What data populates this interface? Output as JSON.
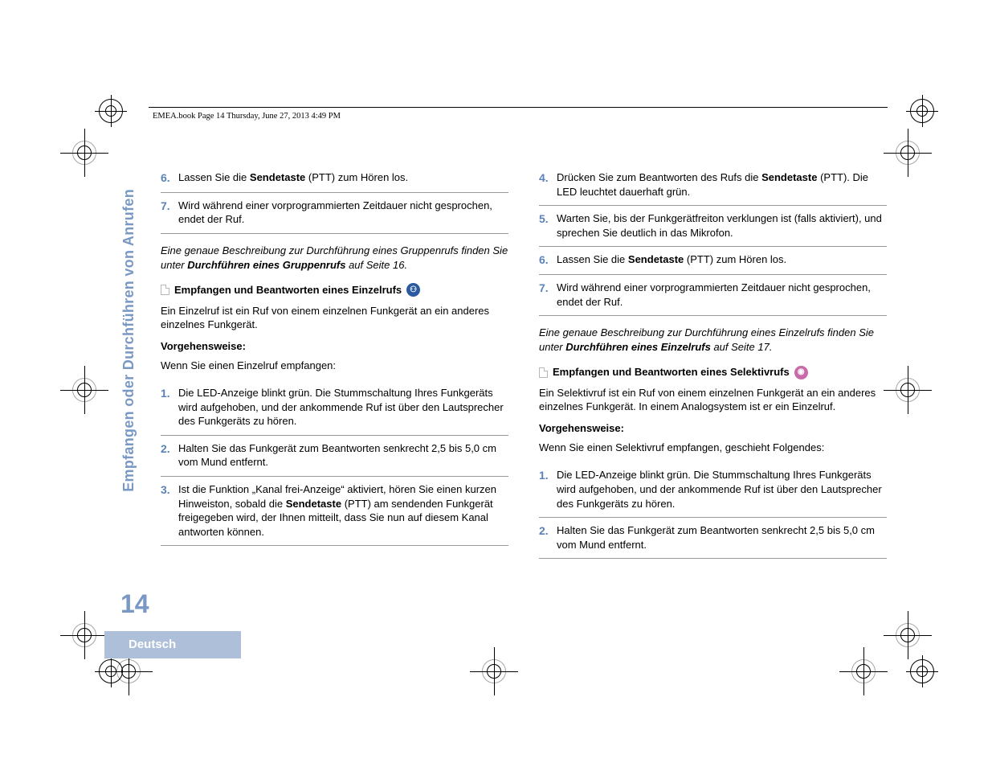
{
  "header": "EMEA.book  Page 14  Thursday, June 27, 2013  4:49 PM",
  "side_title": "Empfangen oder Durchführen von Anrufen",
  "page_number": "14",
  "footer_lang": "Deutsch",
  "left": {
    "topSteps": [
      {
        "n": "6.",
        "html": "Lassen Sie die <b>Sendetaste</b> (PTT) zum Hören los."
      },
      {
        "n": "7.",
        "html": "Wird während einer vorprogrammierten Zeitdauer nicht gesprochen, endet der Ruf."
      }
    ],
    "note_html": "Eine genaue Beschreibung zur Durchführung eines Gruppenrufs finden Sie unter <b>Durchführen eines Gruppenrufs</b> auf Seite 16.",
    "subhead": "Empfangen und Beantworten eines Einzelrufs",
    "intro": "Ein Einzelruf ist ein Ruf von einem einzelnen Funkgerät an ein anderes einzelnes Funkgerät.",
    "proc_label": "Vorgehensweise:",
    "proc_intro": "Wenn Sie einen Einzelruf empfangen:",
    "steps": [
      {
        "n": "1.",
        "html": "Die LED-Anzeige blinkt grün. Die Stummschaltung Ihres Funkgeräts wird aufgehoben, und der ankommende Ruf ist über den Lautsprecher des Funkgeräts zu hören."
      },
      {
        "n": "2.",
        "html": "Halten Sie das Funkgerät zum Beantworten senkrecht 2,5 bis 5,0 cm vom Mund entfernt."
      },
      {
        "n": "3.",
        "html": "Ist die Funktion „Kanal frei-Anzeige“ aktiviert, hören Sie einen kurzen Hinweiston, sobald die <b>Sendetaste</b> (PTT) am sendenden Funkgerät freigegeben wird, der Ihnen mitteilt, dass Sie nun auf diesem Kanal antworten können."
      }
    ]
  },
  "right": {
    "topSteps": [
      {
        "n": "4.",
        "html": "Drücken Sie zum Beantworten des Rufs die <b>Sendetaste</b> (PTT). Die LED leuchtet dauerhaft grün."
      },
      {
        "n": "5.",
        "html": "Warten Sie, bis der Funkgerätfreiton verklungen ist (falls aktiviert), und sprechen Sie deutlich in das Mikrofon."
      },
      {
        "n": "6.",
        "html": "Lassen Sie die <b>Sendetaste</b> (PTT) zum Hören los."
      },
      {
        "n": "7.",
        "html": "Wird während einer vorprogrammierten Zeitdauer nicht gesprochen, endet der Ruf."
      }
    ],
    "note_html": "Eine genaue Beschreibung zur Durchführung eines Einzelrufs finden Sie unter <b>Durchführen eines Einzelrufs</b> auf Seite 17.",
    "subhead": "Empfangen und Beantworten eines Selektivrufs",
    "intro": "Ein Selektivruf ist ein Ruf von einem einzelnen Funkgerät an ein anderes einzelnes Funkgerät. In einem Analogsystem ist er ein Einzelruf.",
    "proc_label": "Vorgehensweise:",
    "proc_intro": "Wenn Sie einen Selektivruf empfangen, geschieht Folgendes:",
    "steps": [
      {
        "n": "1.",
        "html": "Die LED-Anzeige blinkt grün. Die Stummschaltung Ihres Funkgeräts wird aufgehoben, und der ankommende Ruf ist über den Lautsprecher des Funkgeräts zu hören."
      },
      {
        "n": "2.",
        "html": "Halten Sie das Funkgerät zum Beantworten senkrecht 2,5 bis 5,0 cm vom Mund entfernt."
      }
    ]
  }
}
